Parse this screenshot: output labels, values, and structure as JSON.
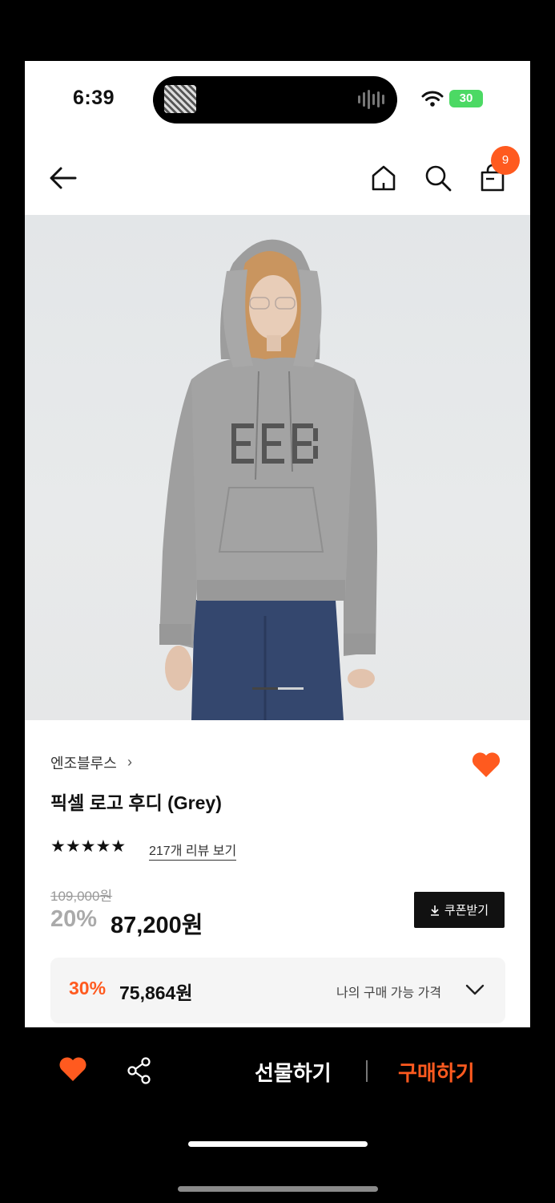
{
  "status_bar": {
    "time": "6:39",
    "battery": "30"
  },
  "nav": {
    "cart_count": "9"
  },
  "product": {
    "brand": "엔조블루스",
    "brand_chevron": "›",
    "title": "픽셀 로고 후디 (Grey)",
    "rating_stars": "★★★★★",
    "review_link": "217개 리뷰 보기",
    "original_price": "109,000원",
    "discount_rate": "20%",
    "sale_price": "87,200원",
    "coupon_button": "쿠폰받기",
    "my_price": {
      "rate": "30%",
      "amount": "75,864원",
      "label": "나의 구매 가능 가격"
    }
  },
  "bottom_bar": {
    "gift_label": "선물하기",
    "buy_label": "구매하기"
  },
  "colors": {
    "accent": "#ff5a1f",
    "dark": "#111111"
  }
}
